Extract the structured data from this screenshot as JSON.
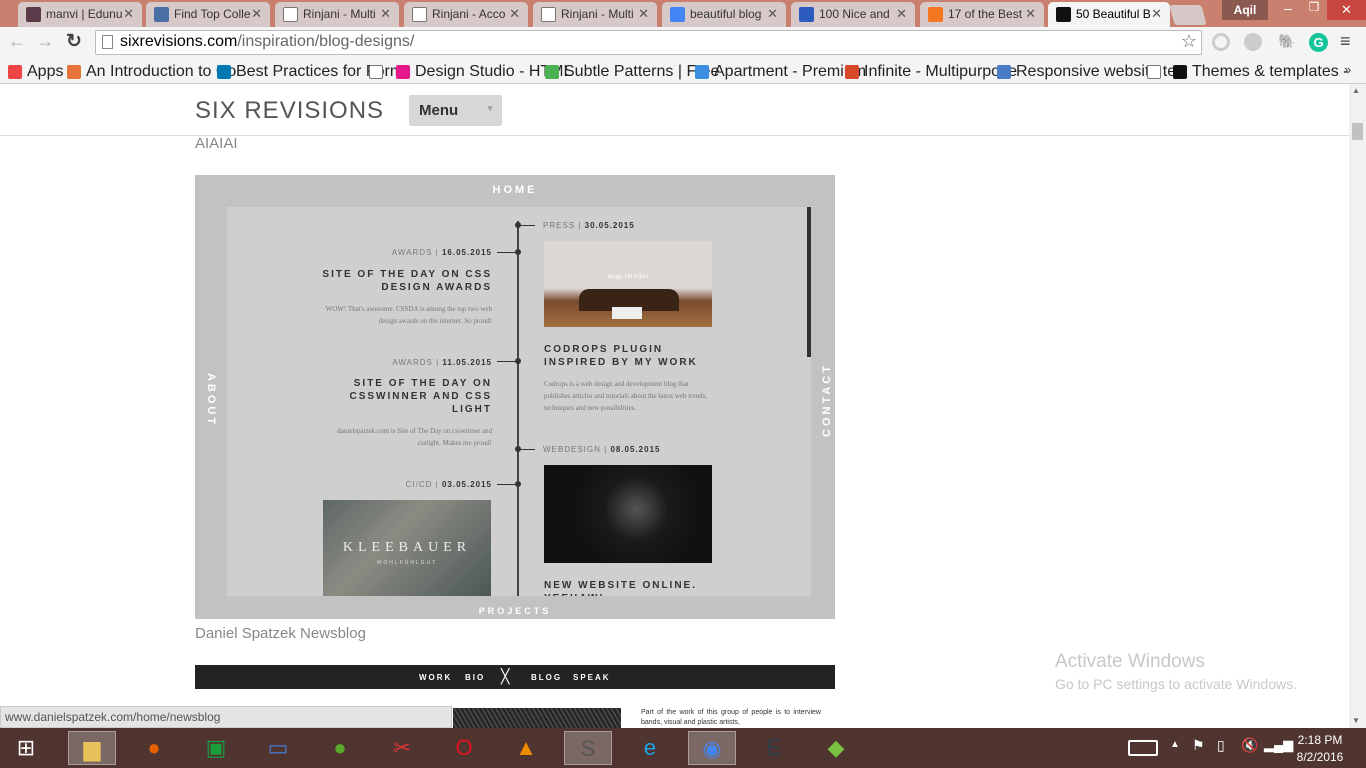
{
  "browser": {
    "tabs": [
      {
        "title": "manvi | Edunu",
        "icon": "hash-icon",
        "color": "#5b3a4a"
      },
      {
        "title": "Find Top Colle",
        "icon": "bird-icon",
        "color": "#4a6fa5"
      },
      {
        "title": "Rinjani - Multi",
        "icon": "page-icon",
        "color": "#fff"
      },
      {
        "title": "Rinjani - Acco",
        "icon": "page-icon",
        "color": "#fff"
      },
      {
        "title": "Rinjani - Multi",
        "icon": "page-icon",
        "color": "#fff"
      },
      {
        "title": "beautiful blog",
        "icon": "google-icon",
        "color": "#4285f4"
      },
      {
        "title": "100 Nice and",
        "icon": "h-icon",
        "color": "#2d5bbd"
      },
      {
        "title": "17 of the Best",
        "icon": "hubspot-icon",
        "color": "#f57722"
      },
      {
        "title": "50 Beautiful B",
        "icon": "s-icon",
        "color": "#111"
      }
    ],
    "user": "Aqil",
    "url_host": "sixrevisions.com",
    "url_path": "/inspiration/blog-designs/",
    "bookmarks": [
      {
        "label": "Apps",
        "color": "#e44"
      },
      {
        "label": "An Introduction to Co",
        "color": "#e8743b"
      },
      {
        "label": "Best Practices for Form",
        "color": "#0077b5"
      },
      {
        "label": "",
        "color": "#fff"
      },
      {
        "label": "Design Studio - HTML",
        "color": "#e5198b"
      },
      {
        "label": "Subtle Patterns | Free",
        "color": "#4caf50"
      },
      {
        "label": "Apartment - Premium",
        "color": "#3b8ee0"
      },
      {
        "label": "Infinite - Multipurpose",
        "color": "#d9472b"
      },
      {
        "label": "Responsive website te",
        "color": "#4a7bc4"
      },
      {
        "label": "",
        "color": "#fff"
      },
      {
        "label": "Themes & templates -",
        "color": "#111"
      }
    ],
    "more": "»",
    "status_url": "www.danielspatzek.com/home/newsblog"
  },
  "site": {
    "logo": "SIX REVISIONS",
    "menu": "Menu",
    "prev_caption": "AIAIAI",
    "caption": "Daniel Spatzek Newsblog"
  },
  "shot": {
    "nav": {
      "top": "HOME",
      "left": "ABOUT",
      "right": "CONTACT",
      "bottom": "PROJECTS"
    },
    "entries": [
      {
        "cat": "PRESS",
        "date": "30.05.2015",
        "title": "CODROPS PLUGIN INSPIRED BY MY WORK",
        "body": "Codrops is a web design and development blog that publishes articles and tutorials about the latest web trends, techniques and new possibilities.",
        "img_text": "Image Tilt Effect"
      },
      {
        "cat": "AWARDS",
        "date": "16.05.2015",
        "title": "SITE OF THE DAY ON CSS DESIGN AWARDS",
        "body": "WOW! That's awesome. CSSDA is among the top two web design awards on the internet. So proud!"
      },
      {
        "cat": "AWARDS",
        "date": "11.05.2015",
        "title": "SITE OF THE DAY ON CSSWINNER AND CSS LIGHT",
        "body": "danielspatzek.com is Site of The Day on csswinner and csslight. Makes me proud!"
      },
      {
        "cat": "WEBDESIGN",
        "date": "08.05.2015",
        "title": "NEW WEBSITE ONLINE. YEEHAW!"
      },
      {
        "cat": "CI/CD",
        "date": "03.05.2015",
        "img_title": "KLEEBAUER",
        "img_sub": "WOHLFÜHLGUT"
      }
    ]
  },
  "next": {
    "nav": [
      "WORK",
      "BIO",
      "BLOG",
      "SPEAK"
    ],
    "partial": "Part of the work of this group of people is to interview bands, visual and plastic artists,"
  },
  "watermark": {
    "title": "Activate Windows",
    "sub": "Go to PC settings to activate Windows."
  },
  "taskbar": {
    "apps": [
      "start",
      "file-explorer",
      "firefox",
      "store",
      "remote-desktop",
      "app-green",
      "snipping-tool",
      "opera",
      "vlc",
      "sublime-text",
      "internet-explorer",
      "chrome",
      "e-app",
      "bluestacks"
    ],
    "time": "2:18 PM",
    "date": "8/2/2016"
  }
}
